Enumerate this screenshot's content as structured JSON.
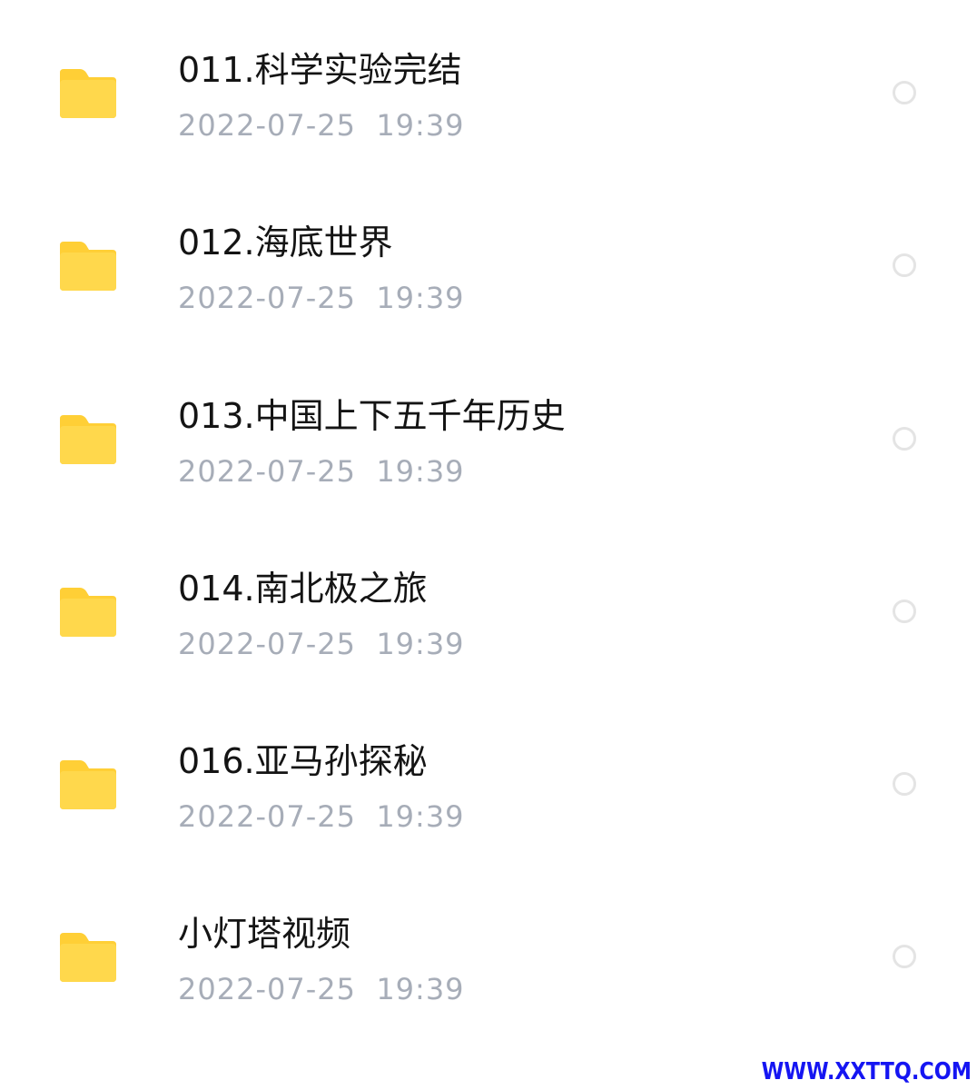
{
  "files": [
    {
      "name": "011.科学实验完结",
      "date": "2022-07-25  19:39",
      "icon": "folder-icon",
      "selected": false
    },
    {
      "name": "012.海底世界",
      "date": "2022-07-25  19:39",
      "icon": "folder-icon",
      "selected": false
    },
    {
      "name": "013.中国上下五千年历史",
      "date": "2022-07-25  19:39",
      "icon": "folder-icon",
      "selected": false
    },
    {
      "name": "014.南北极之旅",
      "date": "2022-07-25  19:39",
      "icon": "folder-icon",
      "selected": false
    },
    {
      "name": "016.亚马孙探秘",
      "date": "2022-07-25  19:39",
      "icon": "folder-icon",
      "selected": false
    },
    {
      "name": "小灯塔视频",
      "date": "2022-07-25  19:39",
      "icon": "folder-icon",
      "selected": false
    }
  ],
  "watermark": "WWW.XXTTQ.COM",
  "colors": {
    "folder": "#FFD84C",
    "folder_tab": "#FFCF36",
    "name_text": "#141414",
    "date_text": "#A7ADB8",
    "radio_border": "#E4E4E4",
    "watermark": "#1515F2"
  }
}
